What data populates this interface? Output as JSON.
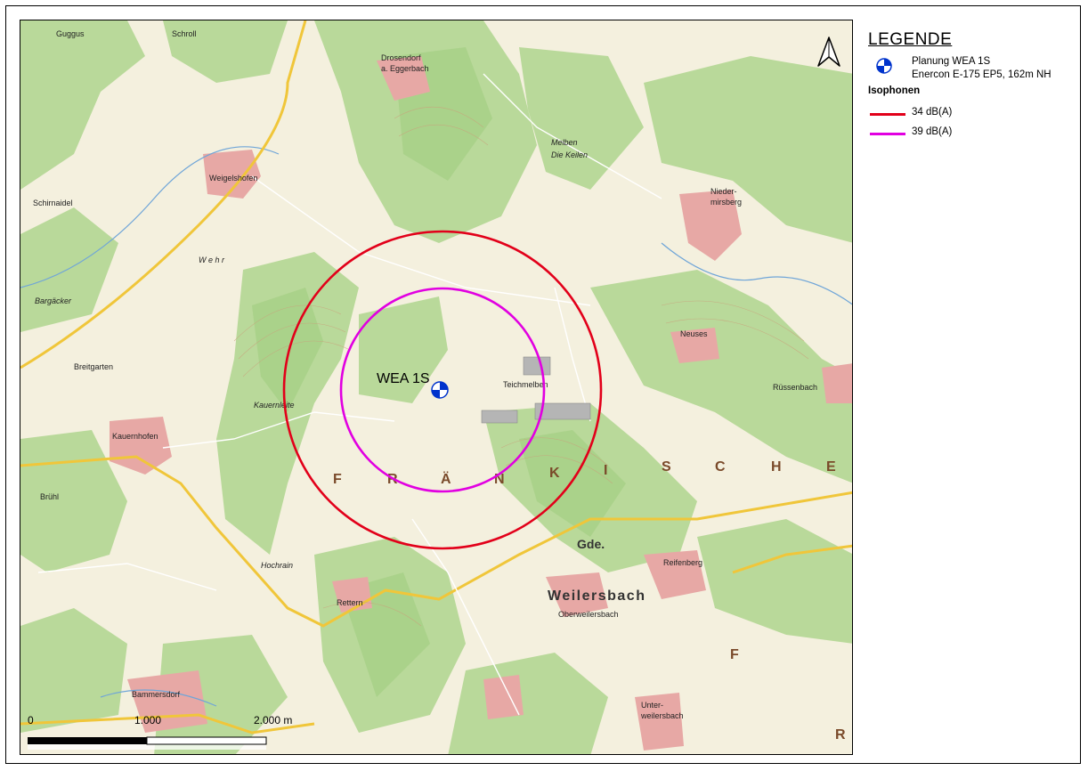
{
  "legend": {
    "title": "LEGENDE",
    "wea_label_line1": "Planung WEA 1S",
    "wea_label_line2": "Enercon E-175 EP5, 162m NH",
    "isophones_heading": "Isophonen",
    "isophones": [
      {
        "label": "34 dB(A)",
        "color": "#e2001a"
      },
      {
        "label": "39 dB(A)",
        "color": "#e100e1"
      }
    ],
    "wea_symbol_color": "#0033cc"
  },
  "map": {
    "turbine_label": "WEA 1S",
    "region_letters_1": [
      "F",
      "R",
      "Ä",
      "N",
      "K",
      "I",
      "S",
      "C",
      "H",
      "E"
    ],
    "region_letters_2": [
      "F",
      "R"
    ],
    "place_names": {
      "weigelshofen": "Weigelshofen",
      "kauernhofen": "Kauernhofen",
      "niedermirsberg_1": "Nieder-",
      "niedermirsberg_2": "mirsberg",
      "russenbach": "Rüssenbach",
      "rettern": "Rettern",
      "oberweilersbach": "Oberweilersbach",
      "gde": "Gde.",
      "weilersbach": "Weilersbach",
      "bammersdorf": "Bammersdorf",
      "unterweilersbach_1": "Unter-",
      "unterweilersbach_2": "weilersbach",
      "drosendorf": "Drosendorf",
      "eggerbach": "a. Eggerbach",
      "reifenberg": "Reifenberg",
      "teichmelben": "Teichmelben",
      "neuses": "Neuses",
      "brueh": "Brühl",
      "breitgarten": "Breitgarten",
      "wehr": "W e h r",
      "schirnaidel": "Schirnaidel",
      "bargacker": "Bargäcker",
      "melben": "Melben",
      "die_keilen": "Die Keilen",
      "guggus": "Guggus",
      "schrott": "Schroll",
      "hochrain": "Hochrain",
      "kauernleite": "Kauernleite"
    }
  },
  "scalebar": {
    "label_0": "0",
    "label_1": "1.000",
    "label_2": "2.000 m"
  },
  "colors": {
    "forest": "#b9d99a",
    "forest_dark": "#a6cf86",
    "field": "#f4f0de",
    "road_yellow": "#f0c63a",
    "settlement": "#e7a8a5",
    "water": "#6fa5d8"
  }
}
